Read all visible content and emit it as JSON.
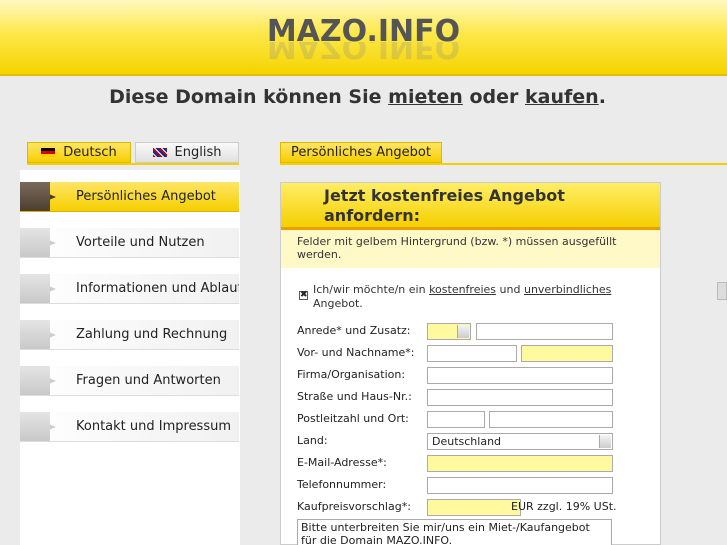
{
  "site": {
    "logo": "MAZO.INFO"
  },
  "headline": {
    "prefix": "Diese Domain können Sie",
    "rent": "mieten",
    "middle": "oder",
    "buy": "kaufen",
    "suffix": "."
  },
  "language_tabs": [
    {
      "label": "Deutsch"
    },
    {
      "label": "English"
    }
  ],
  "content_tab": {
    "label": "Persönliches Angebot"
  },
  "nav": {
    "items": [
      {
        "label": "Persönliches Angebot",
        "active": true
      },
      {
        "label": "Vorteile und Nutzen"
      },
      {
        "label": "Informationen und Ablauf"
      },
      {
        "label": "Zahlung und Rechnung"
      },
      {
        "label": "Fragen und Antworten"
      },
      {
        "label": "Kontakt und Impressum"
      }
    ]
  },
  "form": {
    "title_line1": "Jetzt kostenfreies Angebot",
    "title_line2": "anfordern:",
    "note": "Felder mit gelbem Hintergrund (bzw. *) müssen ausgefüllt werden.",
    "consent": {
      "checked": true,
      "mark": "✖",
      "pre": "Ich/wir möchte/n ein",
      "link1": "kostenfreies",
      "mid": "und",
      "link2": "unverbindliches",
      "post": "Angebot."
    },
    "fields": {
      "anrede": {
        "label": "Anrede* und Zusatz:",
        "select_value": "",
        "zusatz_value": ""
      },
      "name": {
        "label": "Vor- und Nachname*:",
        "first": "",
        "last": ""
      },
      "firma": {
        "label": "Firma/Organisation:",
        "value": ""
      },
      "strasse": {
        "label": "Straße und Haus-Nr.:",
        "value": ""
      },
      "plz": {
        "label": "Postleitzahl und Ort:",
        "plz": "",
        "ort": ""
      },
      "land": {
        "label": "Land:",
        "value": "Deutschland"
      },
      "email": {
        "label": "E-Mail-Adresse*:",
        "value": ""
      },
      "telefon": {
        "label": "Telefonnummer:",
        "value": ""
      },
      "preis": {
        "label": "Kaufpreisvorschlag*:",
        "value": "",
        "unit": "EUR zzgl. 19% USt."
      }
    },
    "message": "Bitte unterbreiten Sie mir/uns ein Miet-/Kaufangebot für die Domain MAZO.INFO."
  },
  "colors": {
    "accent": "#f5cf00",
    "required_bg": "#fff9a0",
    "note_bg": "#fff9c8"
  }
}
